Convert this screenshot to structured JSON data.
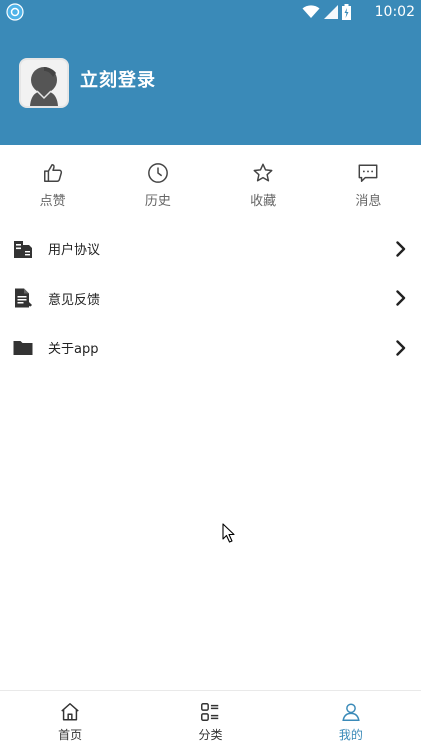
{
  "status_bar": {
    "time": "10:02"
  },
  "profile": {
    "login_label": "立刻登录"
  },
  "quick_actions": [
    {
      "label": "点赞",
      "icon": "thumbs-up-icon"
    },
    {
      "label": "历史",
      "icon": "clock-icon"
    },
    {
      "label": "收藏",
      "icon": "star-icon"
    },
    {
      "label": "消息",
      "icon": "message-icon"
    }
  ],
  "menu_items": [
    {
      "label": "用户协议",
      "icon": "document-icon"
    },
    {
      "label": "意见反馈",
      "icon": "feedback-icon"
    },
    {
      "label": "关于app",
      "icon": "folder-icon"
    }
  ],
  "tabs": [
    {
      "label": "首页",
      "icon": "home-icon",
      "active": false
    },
    {
      "label": "分类",
      "icon": "category-icon",
      "active": false
    },
    {
      "label": "我的",
      "icon": "user-icon",
      "active": true
    }
  ],
  "colors": {
    "accent": "#3a8ab8",
    "text": "#222222",
    "muted": "#666666"
  }
}
